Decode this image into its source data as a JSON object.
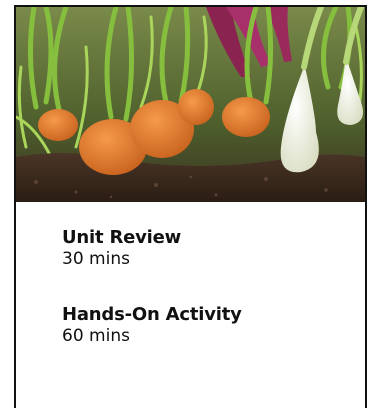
{
  "card": {
    "image_subject": "carrots-and-onions-in-soil",
    "entries": [
      {
        "title": "Unit Review",
        "duration": "30 mins"
      },
      {
        "title": "Hands-On Activity",
        "duration": "60 mins"
      }
    ]
  },
  "colors": {
    "border": "#111111",
    "text": "#111111",
    "soil": "#3b2a1f",
    "carrot": "#e07a2e",
    "foliage": "#7fb33a"
  }
}
